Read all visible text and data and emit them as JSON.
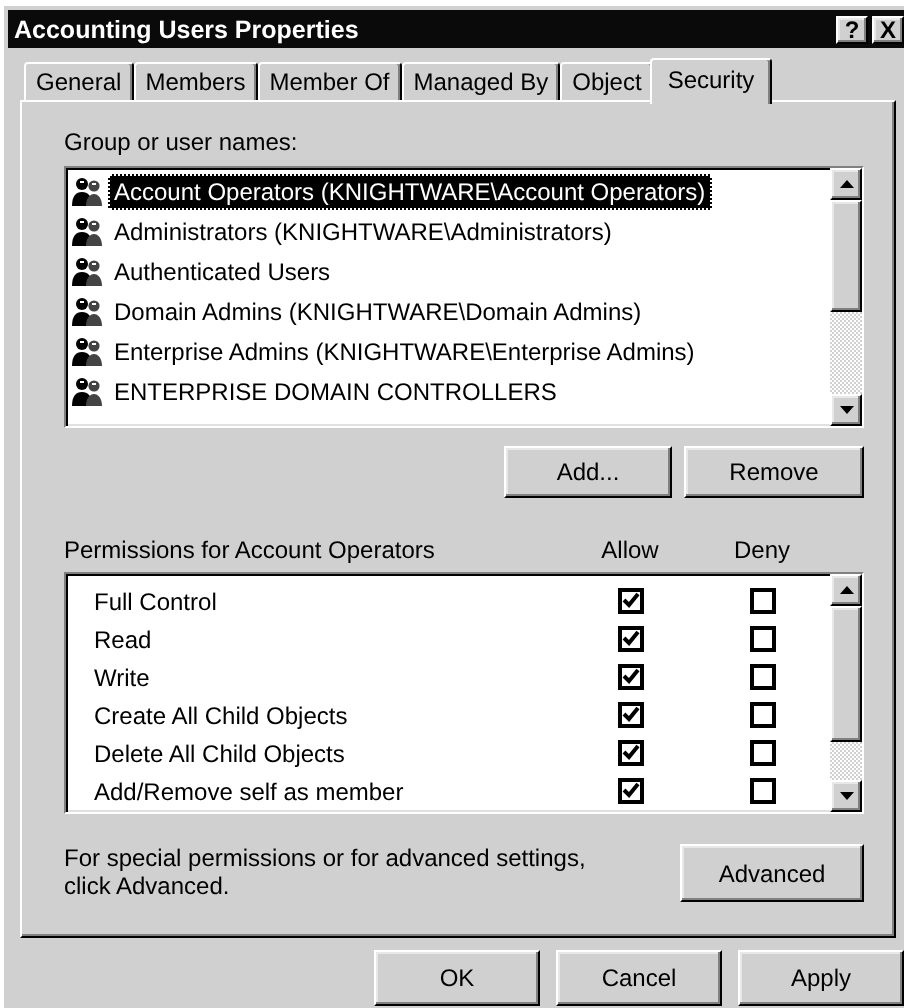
{
  "window": {
    "title": "Accounting Users Properties",
    "help_button": "?",
    "close_button": "X"
  },
  "tabs": [
    {
      "label": "General",
      "selected": false
    },
    {
      "label": "Members",
      "selected": false
    },
    {
      "label": "Member Of",
      "selected": false
    },
    {
      "label": "Managed By",
      "selected": false
    },
    {
      "label": "Object",
      "selected": false
    },
    {
      "label": "Security",
      "selected": true
    }
  ],
  "group_list": {
    "label": "Group or user names:",
    "items": [
      {
        "name": "Account Operators (KNIGHTWARE\\Account Operators)",
        "selected": true
      },
      {
        "name": "Administrators (KNIGHTWARE\\Administrators)",
        "selected": false
      },
      {
        "name": "Authenticated Users",
        "selected": false
      },
      {
        "name": "Domain Admins (KNIGHTWARE\\Domain Admins)",
        "selected": false
      },
      {
        "name": "Enterprise Admins (KNIGHTWARE\\Enterprise Admins)",
        "selected": false
      },
      {
        "name": "ENTERPRISE DOMAIN CONTROLLERS",
        "selected": false
      }
    ]
  },
  "group_buttons": [
    {
      "label": "Add..."
    },
    {
      "label": "Remove"
    }
  ],
  "permissions": {
    "label": "Permissions for Account Operators",
    "allow_header": "Allow",
    "deny_header": "Deny",
    "rows": [
      {
        "name": "Full Control",
        "allow": true,
        "deny": false
      },
      {
        "name": "Read",
        "allow": true,
        "deny": false
      },
      {
        "name": "Write",
        "allow": true,
        "deny": false
      },
      {
        "name": "Create All Child Objects",
        "allow": true,
        "deny": false
      },
      {
        "name": "Delete All Child Objects",
        "allow": true,
        "deny": false
      },
      {
        "name": "Add/Remove self as member",
        "allow": true,
        "deny": false
      }
    ]
  },
  "advanced": {
    "note": "For special permissions or for advanced settings, click Advanced.",
    "button": {
      "label": "Advanced"
    }
  },
  "footer_buttons": [
    {
      "label": "OK"
    },
    {
      "label": "Cancel"
    },
    {
      "label": "Apply"
    }
  ]
}
